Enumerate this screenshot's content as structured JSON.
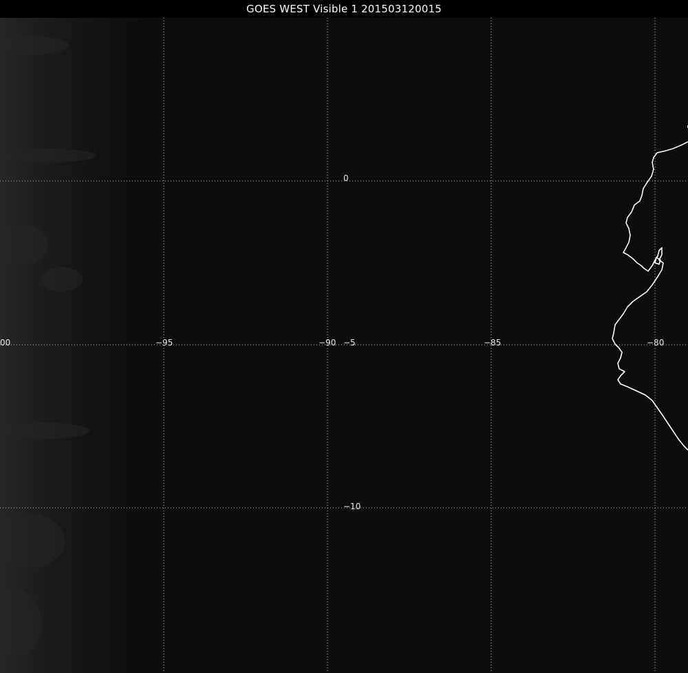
{
  "title": "GOES WEST Visible 1 201503120015",
  "colors": {
    "background": "#0c0c0c",
    "grid": "#bdbdbd",
    "coastline": "#ffffff",
    "title_bar": "#000000"
  },
  "grid": {
    "longitude_labels": [
      "00",
      "−95",
      "−90",
      "−85",
      "−80"
    ],
    "latitude_labels": [
      "0",
      "−5",
      "−10"
    ]
  },
  "features": [
    "coastline-ecuador-peru",
    "cloud-texture-west"
  ]
}
